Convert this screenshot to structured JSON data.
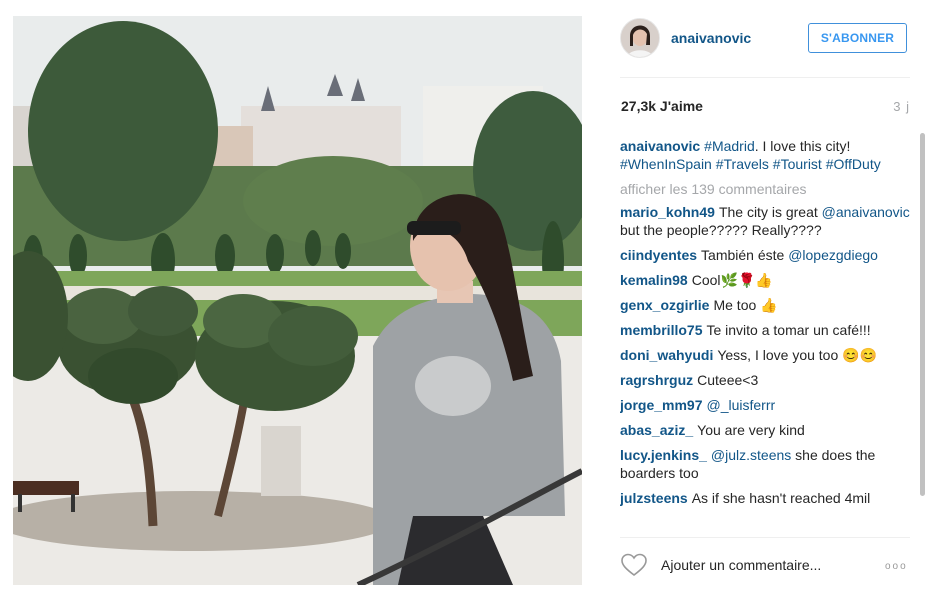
{
  "post": {
    "photo_alt": "",
    "username": "anaivanovic",
    "follow_label": "S'ABONNER",
    "likes": "27,3k J'aime",
    "age": "3 j",
    "caption": {
      "user": "anaivanovic",
      "parts": [
        "#Madrid",
        ". I love this city! ",
        "#WhenInSpain",
        " ",
        "#Travels",
        " ",
        "#Tourist",
        " ",
        "#OffDuty"
      ]
    },
    "view_all": "afficher les 139 commentaires",
    "comments": [
      {
        "user": "mario_kohn49",
        "text": "The city is great ",
        "mention": "@anaivanovic",
        "text2": " but the people????? Really????"
      },
      {
        "user": "ciindyentes",
        "text": "También éste ",
        "mention": "@lopezgdiego",
        "text2": ""
      },
      {
        "user": "kemalin98",
        "text": "Cool🌿🌹👍",
        "mention": "",
        "text2": ""
      },
      {
        "user": "genx_ozgirlie",
        "text": "Me too 👍",
        "mention": "",
        "text2": ""
      },
      {
        "user": "membrillo75",
        "text": "Te invito a tomar un café!!!",
        "mention": "",
        "text2": ""
      },
      {
        "user": "doni_wahyudi",
        "text": "Yess, I love you too 😊😊",
        "mention": "",
        "text2": ""
      },
      {
        "user": "ragrshrguz",
        "text": "Cuteee<3",
        "mention": "",
        "text2": ""
      },
      {
        "user": "jorge_mm97",
        "text": "",
        "mention": "@_luisferrr",
        "text2": ""
      },
      {
        "user": "abas_aziz_",
        "text": "You are very kind",
        "mention": "",
        "text2": ""
      },
      {
        "user": "lucy.jenkins_",
        "text": "",
        "mention": "@julz.steens",
        "text2": " she does the boarders too"
      },
      {
        "user": "julzsteens",
        "text": "As if she hasn't reached 4mil",
        "mention": "",
        "text2": ""
      }
    ],
    "add_comment_placeholder": "Ajouter un commentaire...",
    "more_options": "ooo"
  },
  "icons": {
    "heart": "heart-icon",
    "more": "more-options-icon"
  },
  "colors": {
    "link": "#125688",
    "follow": "#3897f0",
    "muted": "#a5a7aa"
  }
}
